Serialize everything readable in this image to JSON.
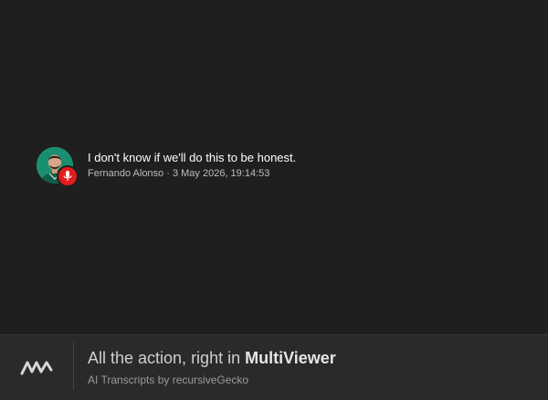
{
  "message": {
    "text": "I don't know if we'll do this to be honest.",
    "author": "Fernando Alonso",
    "separator": " · ",
    "timestamp": "3 May 2026, 19:14:53",
    "avatar_icon": "driver-avatar",
    "badge_icon": "microphone-icon"
  },
  "footer": {
    "title_prefix": "All the action, right in ",
    "title_brand": "MultiViewer",
    "subtitle": "AI Transcripts by recursiveGecko",
    "logo_icon": "multiviewer-logo-icon"
  },
  "colors": {
    "background": "#1f1f1f",
    "footer_background": "#2a2a2a",
    "badge_red": "#e31b1b",
    "avatar_green": "#1a8f6f"
  }
}
